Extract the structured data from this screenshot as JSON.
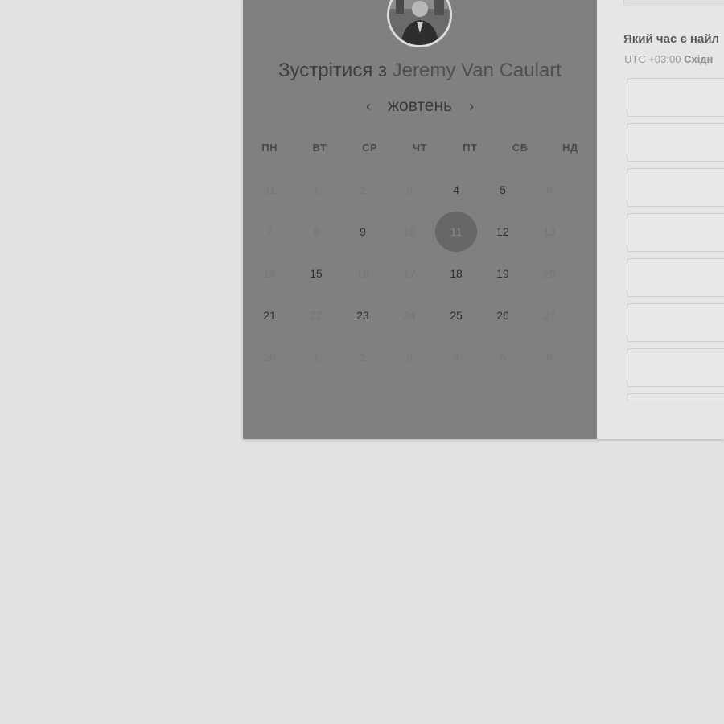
{
  "meeting": {
    "title_prefix": "Зустрітися з",
    "host_name": "Jeremy Van Caulart"
  },
  "calendar": {
    "month": "жовтень",
    "prev_icon": "chevron-left-icon",
    "next_icon": "chevron-right-icon",
    "weekdays": [
      "ПН",
      "ВТ",
      "СР",
      "ЧТ",
      "ПТ",
      "СБ",
      "НД"
    ],
    "selected_day": "11",
    "weeks": [
      [
        {
          "d": "31",
          "a": false
        },
        {
          "d": "1",
          "a": false
        },
        {
          "d": "2",
          "a": false
        },
        {
          "d": "3",
          "a": false
        },
        {
          "d": "4",
          "a": true
        },
        {
          "d": "5",
          "a": true
        },
        {
          "d": "6",
          "a": false
        }
      ],
      [
        {
          "d": "7",
          "a": false
        },
        {
          "d": "8",
          "a": false
        },
        {
          "d": "9",
          "a": true
        },
        {
          "d": "10",
          "a": false
        },
        {
          "d": "11",
          "a": true,
          "s": true
        },
        {
          "d": "12",
          "a": true
        },
        {
          "d": "13",
          "a": false
        }
      ],
      [
        {
          "d": "14",
          "a": false
        },
        {
          "d": "15",
          "a": true
        },
        {
          "d": "16",
          "a": false
        },
        {
          "d": "17",
          "a": false
        },
        {
          "d": "18",
          "a": true
        },
        {
          "d": "19",
          "a": true
        },
        {
          "d": "20",
          "a": false
        }
      ],
      [
        {
          "d": "21",
          "a": true
        },
        {
          "d": "22",
          "a": false
        },
        {
          "d": "23",
          "a": true
        },
        {
          "d": "24",
          "a": false
        },
        {
          "d": "25",
          "a": true
        },
        {
          "d": "26",
          "a": true
        },
        {
          "d": "27",
          "a": false
        }
      ],
      [
        {
          "d": "28",
          "a": false
        },
        {
          "d": "1",
          "a": false
        },
        {
          "d": "2",
          "a": false
        },
        {
          "d": "3",
          "a": false
        },
        {
          "d": "4",
          "a": false
        },
        {
          "d": "5",
          "a": false
        },
        {
          "d": "6",
          "a": false
        }
      ]
    ]
  },
  "time_panel": {
    "question": "Який час є найл",
    "tz_offset": "UTC +03:00",
    "tz_name": "Східн",
    "slot_count": 8
  }
}
